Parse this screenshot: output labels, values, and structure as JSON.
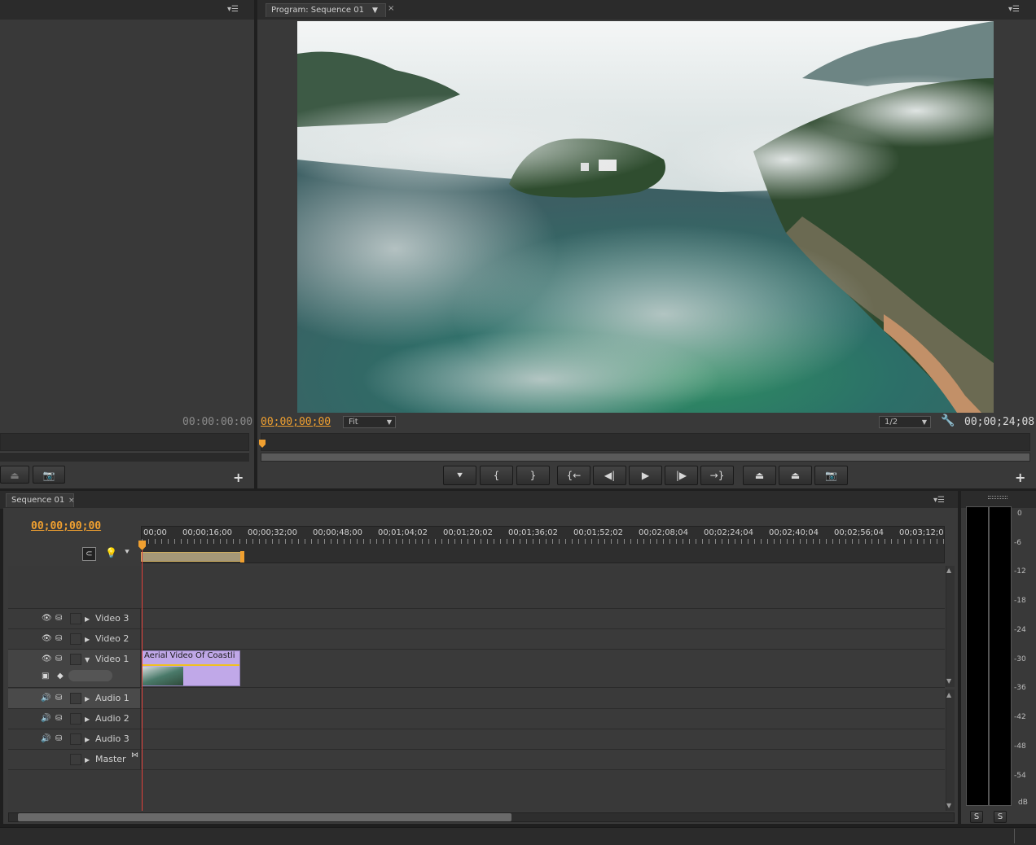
{
  "source_monitor": {
    "timecode": "00:00:00:00",
    "add_label": "+"
  },
  "program_monitor": {
    "tab_label": "Program: Sequence 01",
    "tab_dropdown_icon": "chevron-down-icon",
    "tab_close": "×",
    "timecode_current": "00;00;00;00",
    "zoom_value": "Fit",
    "resolution_value": "1/2",
    "timecode_duration": "00;00;24;08",
    "add_label": "+",
    "transport_buttons": [
      {
        "name": "add-marker-button",
        "glyph": "⯆"
      },
      {
        "name": "mark-in-button",
        "glyph": "{"
      },
      {
        "name": "mark-out-button",
        "glyph": "}"
      },
      {
        "name": "go-to-in-button",
        "glyph": "{←"
      },
      {
        "name": "step-back-button",
        "glyph": "◀|"
      },
      {
        "name": "play-button",
        "glyph": "▶"
      },
      {
        "name": "step-forward-button",
        "glyph": "|▶"
      },
      {
        "name": "go-to-out-button",
        "glyph": "→}"
      },
      {
        "name": "lift-button",
        "glyph": "⏏"
      },
      {
        "name": "extract-button",
        "glyph": "⏏"
      },
      {
        "name": "export-frame-button",
        "glyph": "📷"
      }
    ]
  },
  "timeline": {
    "tab_label": "Sequence 01",
    "tab_close": "×",
    "timecode": "00;00;00;00",
    "ruler_labels": [
      "00;00",
      "00;00;16;00",
      "00;00;32;00",
      "00;00;48;00",
      "00;01;04;02",
      "00;01;20;02",
      "00;01;36;02",
      "00;01;52;02",
      "00;02;08;04",
      "00;02;24;04",
      "00;02;40;04",
      "00;02;56;04",
      "00;03;12;0"
    ],
    "video_tracks": [
      {
        "label": "Video 3"
      },
      {
        "label": "Video 2"
      },
      {
        "label": "Video 1"
      }
    ],
    "audio_tracks": [
      {
        "label": "Audio 1"
      },
      {
        "label": "Audio 2"
      },
      {
        "label": "Audio 3"
      }
    ],
    "master_label": "Master",
    "clip_title": "Aerial Video Of Coastli",
    "colors": {
      "clip": "#c0a8e8",
      "playhead": "#e0413b",
      "timecode": "#f0a030"
    }
  },
  "audio_meter": {
    "labels": [
      "0",
      "-6",
      "-12",
      "-18",
      "-24",
      "-30",
      "-36",
      "-42",
      "-48",
      "-54",
      "dB"
    ],
    "solo_left": "S",
    "solo_right": "S"
  }
}
